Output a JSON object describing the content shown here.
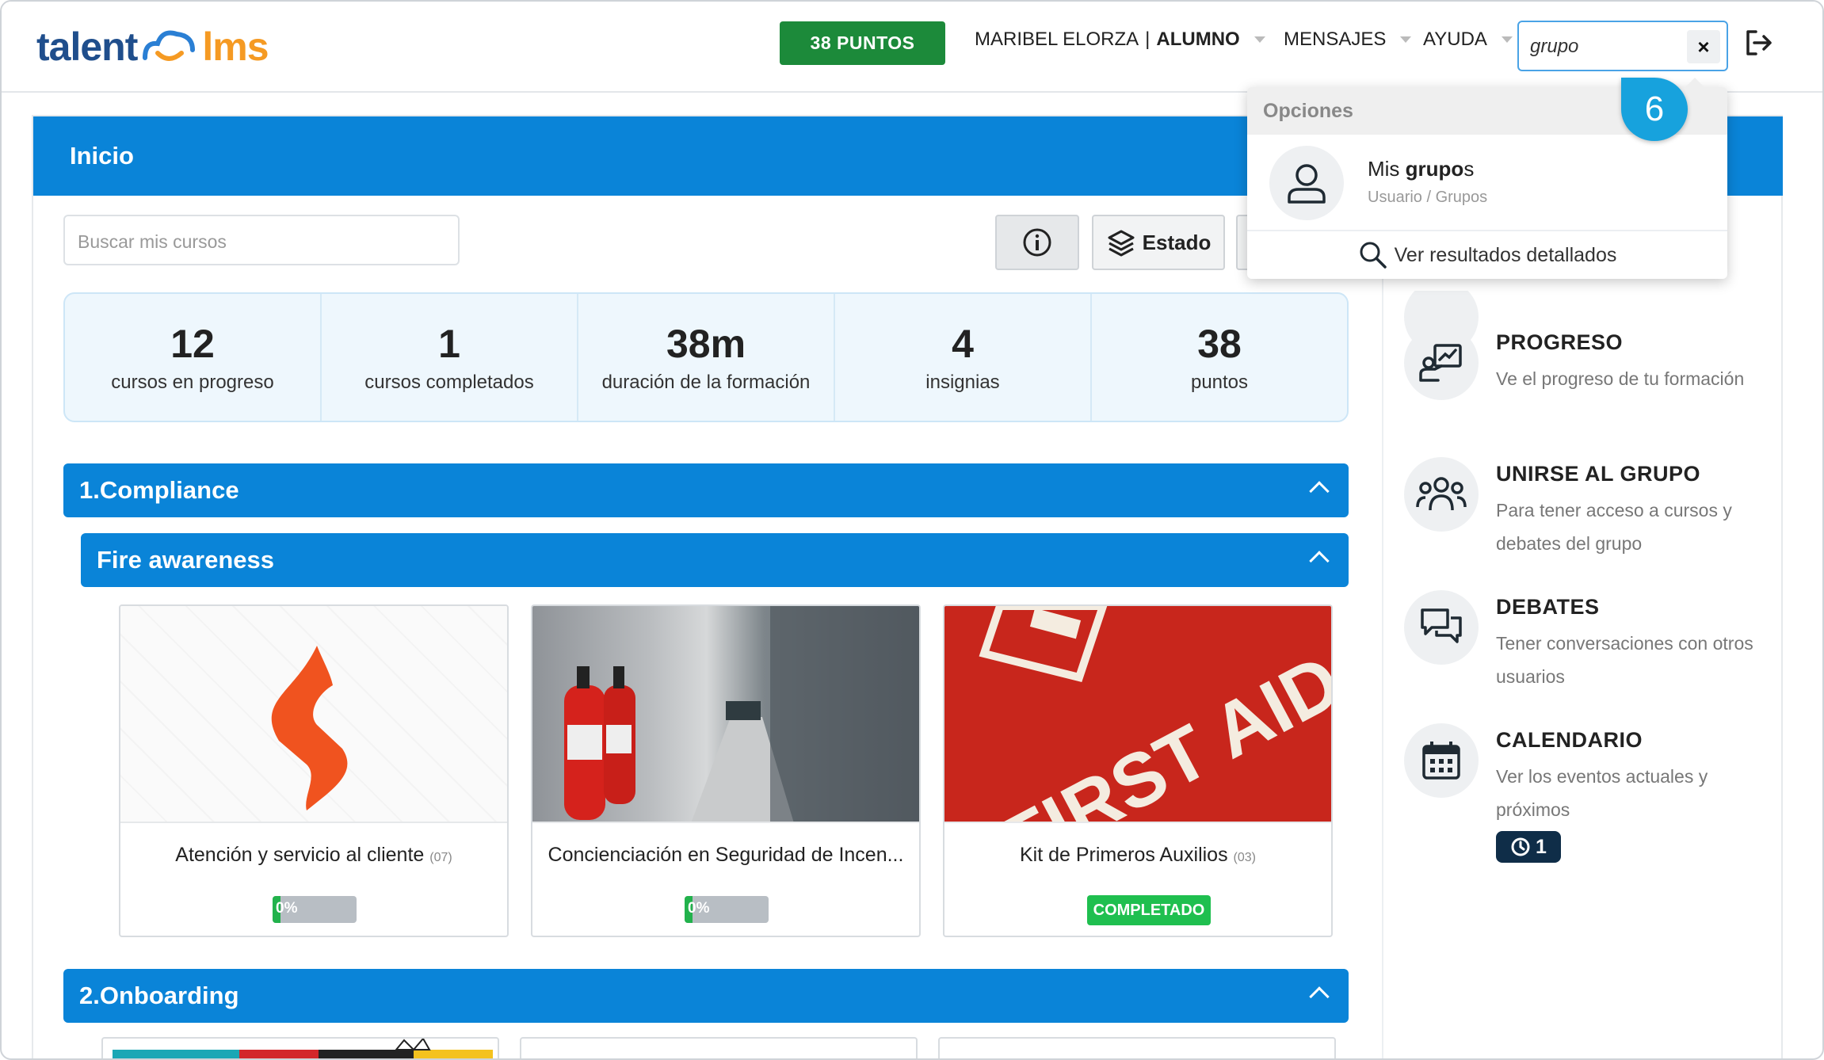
{
  "header": {
    "logo_left": "talent",
    "logo_right": "lms",
    "points_label": "38 PUNTOS",
    "user_name": "MARIBEL ELORZA",
    "separator": "|",
    "user_role": "ALUMNO",
    "messages": "MENSAJES",
    "help": "AYUDA",
    "search_value": "grupo",
    "clear_label": "×"
  },
  "search_dropdown": {
    "section_title": "Opciones",
    "result_prefix": "Mis ",
    "result_match": "grupo",
    "result_suffix": "s",
    "result_path": "Usuario / Grupos",
    "more_results": "Ver resultados detallados",
    "step_number": "6"
  },
  "main": {
    "title": "Inicio",
    "search_placeholder": "Buscar mis cursos",
    "estado_label": "Estado",
    "stats": [
      {
        "value": "12",
        "label": "cursos en progreso"
      },
      {
        "value": "1",
        "label": "cursos completados"
      },
      {
        "value": "38m",
        "label": "duración de la formación"
      },
      {
        "value": "4",
        "label": "insignias"
      },
      {
        "value": "38",
        "label": "puntos"
      }
    ],
    "categories": [
      {
        "name": "1.Compliance"
      },
      {
        "name": "Fire awareness"
      },
      {
        "name": "2.Onboarding"
      }
    ],
    "courses": [
      {
        "title": "Atención y servicio al cliente",
        "code": "(07)",
        "progress_label": "0%",
        "progress": 0
      },
      {
        "title": "Concienciación en Seguridad de Incen...",
        "code": "",
        "progress_label": "0%",
        "progress": 0
      },
      {
        "title": "Kit de Primeros Auxilios",
        "code": "(03)",
        "status": "COMPLETADO"
      }
    ],
    "first_aid_text": "FIRST AID"
  },
  "sidebar": {
    "items": [
      {
        "title": "PROGRESO",
        "desc": "Ve el progreso de tu formación",
        "icon": "progress-icon"
      },
      {
        "title": "UNIRSE AL GRUPO",
        "desc": "Para tener acceso a cursos y debates del grupo",
        "icon": "group-icon"
      },
      {
        "title": "DEBATES",
        "desc": "Tener conversaciones con otros usuarios",
        "icon": "discussion-icon"
      },
      {
        "title": "CALENDARIO",
        "desc": "Ver los eventos actuales y próximos",
        "icon": "calendar-icon"
      }
    ],
    "calendar_badge": "1"
  },
  "colors": {
    "primary": "#0a84d8",
    "points": "#1c8a3a",
    "success": "#1fbf4f",
    "step": "#17a2dd"
  }
}
